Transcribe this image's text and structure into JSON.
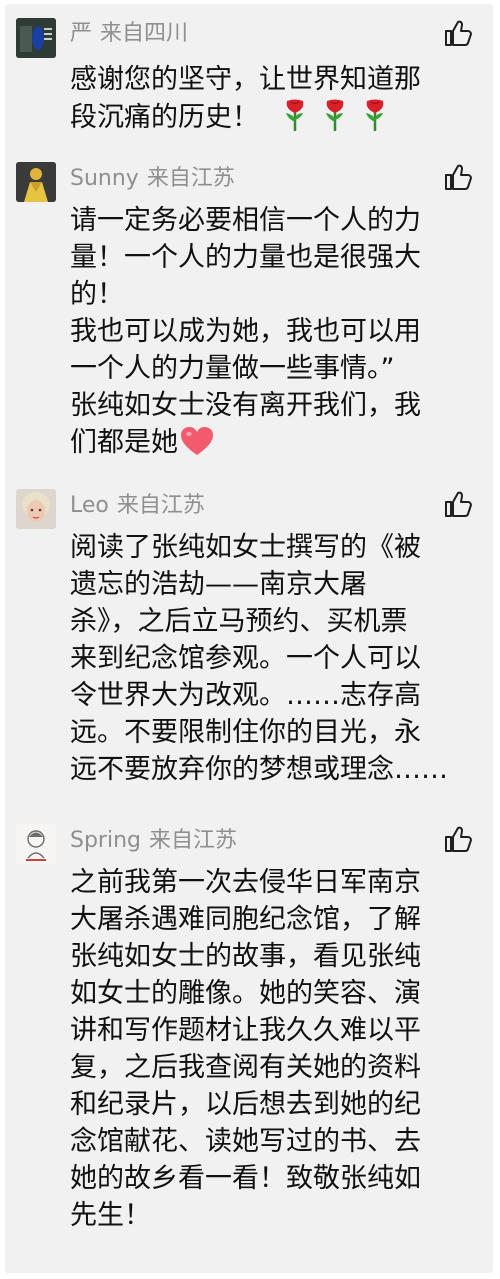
{
  "comments": [
    {
      "name": "严",
      "location": "来自四川",
      "lines": [
        "感谢您的坚守，让世界知道那",
        "段沉痛的历史！"
      ],
      "trailing_icons": [
        "rose-icon",
        "rose-icon",
        "rose-icon"
      ]
    },
    {
      "name": "Sunny",
      "location": "来自江苏",
      "lines": [
        "请一定务必要相信一个人的力",
        "量！一个人的力量也是很强大",
        "的！",
        "我也可以成为她，我也可以用",
        "一个人的力量做一些事情。”",
        "张纯如女士没有离开我们，我",
        "们都是她"
      ],
      "trailing_icons": [
        "heart-icon"
      ]
    },
    {
      "name": "Leo",
      "location": "来自江苏",
      "lines": [
        "阅读了张纯如女士撰写的《被",
        "遗忘的浩劫——南京大屠",
        "杀》，之后立马预约、买机票",
        "来到纪念馆参观。一个人可以",
        "令世界大为改观。……志存高",
        "远。不要限制住你的目光，永",
        "远不要放弃你的梦想或理念……"
      ]
    },
    {
      "name": "Spring",
      "location": "来自江苏",
      "lines": [
        "之前我第一次去侵华日军南京",
        "大屠杀遇难同胞纪念馆，了解",
        "张纯如女士的故事，看见张纯",
        "如女士的雕像。她的笑容、演",
        "讲和写作题材让我久久难以平",
        "复，之后我查阅有关她的资料",
        "和纪录片，以后想去到她的纪",
        "念馆献花、读她写过的书、去",
        "她的故乡看一看！致敬张纯如",
        "先生！"
      ]
    }
  ],
  "colors": {
    "panel_bg": "#f1f1f1",
    "meta_text": "#8f8f8f",
    "body_text": "#111111",
    "like_icon": "#1f1f1f",
    "rose": "#d8202a",
    "heart": "#f25b6e"
  }
}
